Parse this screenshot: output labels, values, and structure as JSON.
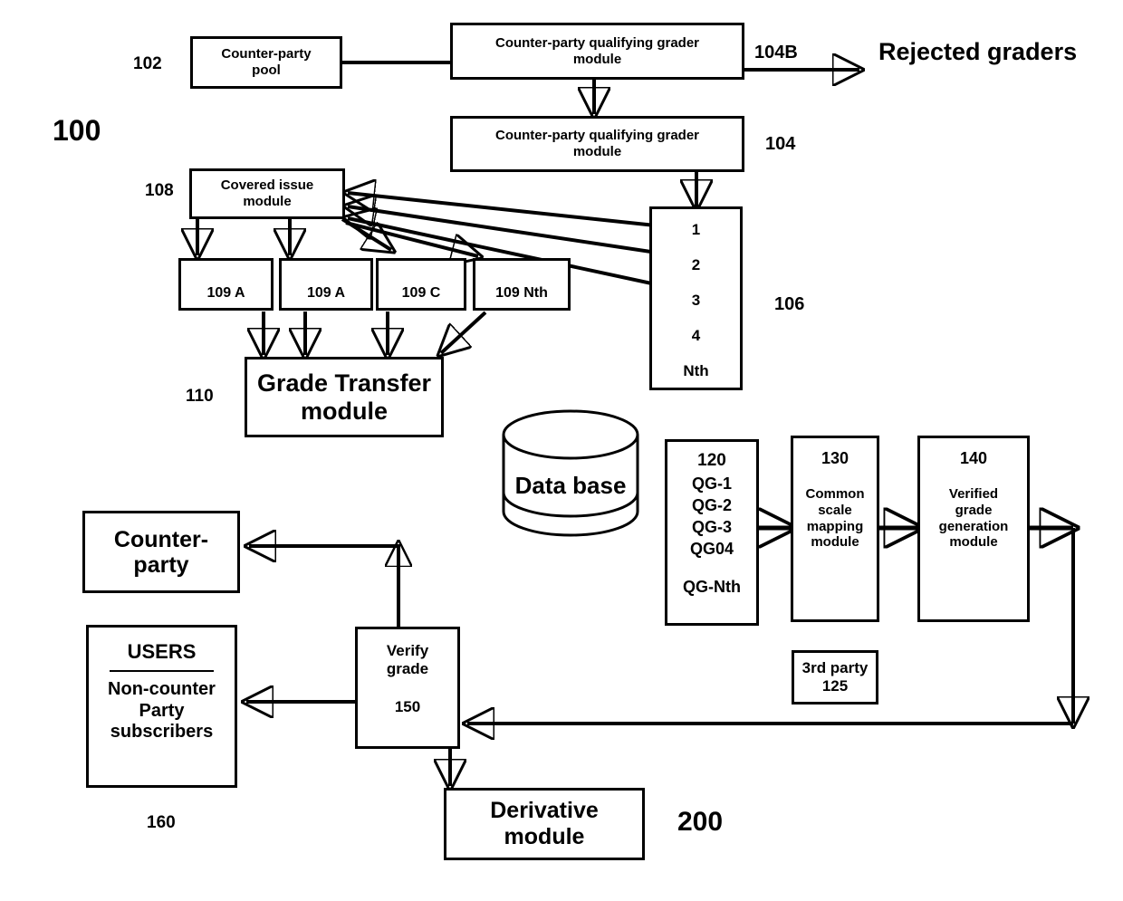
{
  "figure": {
    "main_ref": "100",
    "secondary_ref": "200"
  },
  "labels": {
    "ref_102": "102",
    "ref_104": "104",
    "ref_104b": "104B",
    "ref_106": "106",
    "ref_108": "108",
    "ref_110": "110",
    "ref_160": "160"
  },
  "boxes": {
    "counter_party_pool": {
      "line1": "Counter-party",
      "line2": "pool"
    },
    "cp_qualifying_grader_top": {
      "line1": "Counter-party qualifying grader",
      "line2": "module"
    },
    "cp_qualifying_grader_second": {
      "line1": "Counter-party qualifying grader",
      "line2": "module"
    },
    "covered_issue": {
      "line1": "Covered issue",
      "line2": "module"
    },
    "issue_109a_1": {
      "line1": "109 A"
    },
    "issue_109a_2": {
      "line1": "109 A"
    },
    "issue_109c": {
      "line1": "109 C"
    },
    "issue_109nth": {
      "line1": "109 Nth"
    },
    "grade_transfer": {
      "line1": "Grade Transfer",
      "line2": "module"
    },
    "counter_party": {
      "line1": "Counter-",
      "line2": "party"
    },
    "users": {
      "title": "USERS",
      "line1": "Non-counter",
      "line2": "Party",
      "line3": "subscribers"
    },
    "verify_grade": {
      "line1": "Verify",
      "line2": "grade",
      "ref": "150"
    },
    "derivative": {
      "line1": "Derivative",
      "line2": "module"
    },
    "common_scale_mapping": {
      "ref": "130",
      "line1": "Common",
      "line2": "scale",
      "line3": "mapping",
      "line4": "module"
    },
    "verified_grade_generation": {
      "ref": "140",
      "line1": "Verified",
      "line2": "grade",
      "line3": "generation",
      "line4": "module"
    },
    "third_party": {
      "line1": "3rd party",
      "line2": "125"
    },
    "database": {
      "label": "Data base"
    }
  },
  "grader_list": {
    "items": [
      "1",
      "2",
      "3",
      "4",
      "Nth"
    ]
  },
  "qg_list": {
    "ref": "120",
    "items": [
      "QG-1",
      "QG-2",
      "QG-3",
      "QG04",
      "",
      "QG-Nth"
    ]
  },
  "output": {
    "rejected_graders": "Rejected graders"
  }
}
